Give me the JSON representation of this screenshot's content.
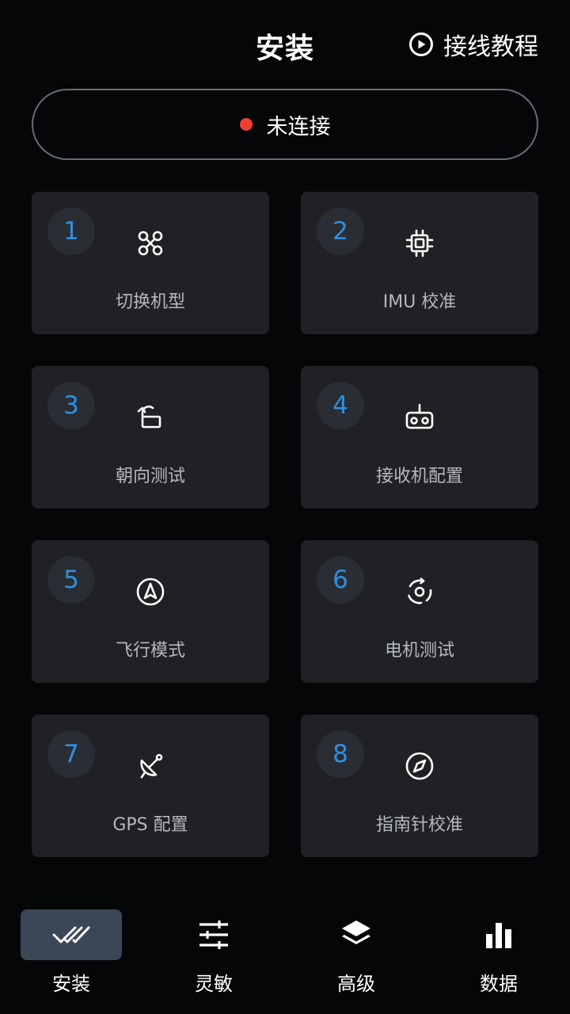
{
  "header": {
    "title": "安装",
    "tutorial_label": "接线教程",
    "tutorial_icon": "play-circle-icon"
  },
  "connection": {
    "status": "未连接",
    "status_color": "#ef3f35"
  },
  "cards": [
    {
      "number": "1",
      "label": "切换机型",
      "icon": "drone-icon"
    },
    {
      "number": "2",
      "label": "IMU 校准",
      "icon": "chip-icon"
    },
    {
      "number": "3",
      "label": "朝向测试",
      "icon": "orientation-icon"
    },
    {
      "number": "4",
      "label": "接收机配置",
      "icon": "receiver-icon"
    },
    {
      "number": "5",
      "label": "飞行模式",
      "icon": "navigation-icon"
    },
    {
      "number": "6",
      "label": "电机测试",
      "icon": "motor-icon"
    },
    {
      "number": "7",
      "label": "GPS 配置",
      "icon": "satellite-dish-icon"
    },
    {
      "number": "8",
      "label": "指南针校准",
      "icon": "compass-icon"
    }
  ],
  "nav": {
    "items": [
      {
        "label": "安装",
        "icon": "double-check-icon",
        "active": true
      },
      {
        "label": "灵敏",
        "icon": "sliders-icon",
        "active": false
      },
      {
        "label": "高级",
        "icon": "layers-icon",
        "active": false
      },
      {
        "label": "数据",
        "icon": "bar-chart-icon",
        "active": false
      }
    ]
  },
  "colors": {
    "background": "#050608",
    "card": "#202124",
    "accent_blue": "#2e8fe3",
    "active_tab": "#3b4656",
    "disconnected_dot": "#ef3f35"
  }
}
